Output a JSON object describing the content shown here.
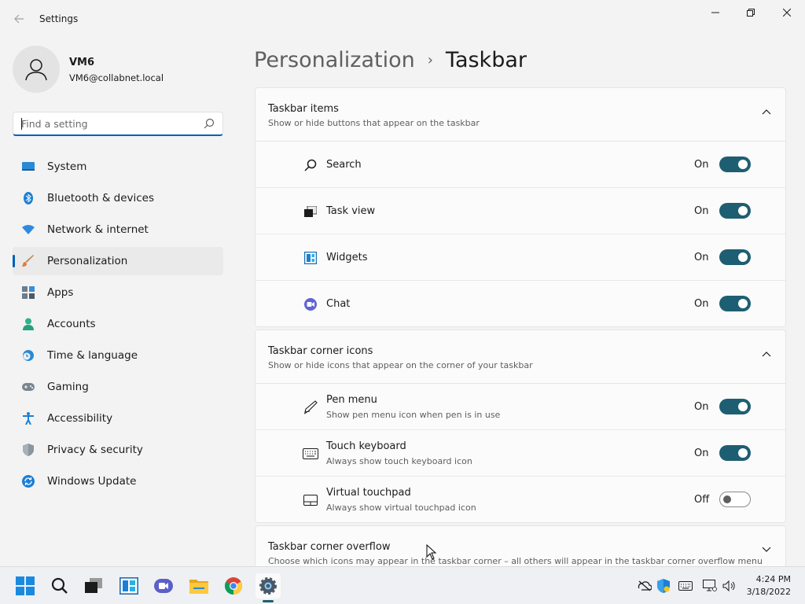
{
  "window": {
    "app_title": "Settings",
    "back_icon": "back-arrow-icon",
    "controls": [
      "minimize-icon",
      "restore-icon",
      "close-icon"
    ]
  },
  "profile": {
    "name": "VM6",
    "email": "VM6@collabnet.local"
  },
  "search": {
    "placeholder": "Find a setting",
    "value": ""
  },
  "sidebar": {
    "items": [
      {
        "label": "System",
        "icon": "system-icon",
        "active": false
      },
      {
        "label": "Bluetooth & devices",
        "icon": "bluetooth-icon",
        "active": false
      },
      {
        "label": "Network & internet",
        "icon": "wifi-icon",
        "active": false
      },
      {
        "label": "Personalization",
        "icon": "brush-icon",
        "active": true
      },
      {
        "label": "Apps",
        "icon": "apps-icon",
        "active": false
      },
      {
        "label": "Accounts",
        "icon": "accounts-icon",
        "active": false
      },
      {
        "label": "Time & language",
        "icon": "clock-globe-icon",
        "active": false
      },
      {
        "label": "Gaming",
        "icon": "gamepad-icon",
        "active": false
      },
      {
        "label": "Accessibility",
        "icon": "accessibility-icon",
        "active": false
      },
      {
        "label": "Privacy & security",
        "icon": "shield-icon",
        "active": false
      },
      {
        "label": "Windows Update",
        "icon": "update-icon",
        "active": false
      }
    ]
  },
  "breadcrumb": {
    "parent": "Personalization",
    "separator": "›",
    "current": "Taskbar"
  },
  "sections": [
    {
      "title": "Taskbar items",
      "subtitle": "Show or hide buttons that appear on the taskbar",
      "expanded": true,
      "rows": [
        {
          "label": "Search",
          "icon": "search-icon",
          "state": "On",
          "on": true
        },
        {
          "label": "Task view",
          "icon": "task-view-icon",
          "state": "On",
          "on": true
        },
        {
          "label": "Widgets",
          "icon": "widgets-icon",
          "state": "On",
          "on": true
        },
        {
          "label": "Chat",
          "icon": "chat-icon",
          "state": "On",
          "on": true
        }
      ]
    },
    {
      "title": "Taskbar corner icons",
      "subtitle": "Show or hide icons that appear on the corner of your taskbar",
      "expanded": true,
      "rows": [
        {
          "label": "Pen menu",
          "sub": "Show pen menu icon when pen is in use",
          "icon": "pen-icon",
          "state": "On",
          "on": true
        },
        {
          "label": "Touch keyboard",
          "sub": "Always show touch keyboard icon",
          "icon": "keyboard-icon",
          "state": "On",
          "on": true
        },
        {
          "label": "Virtual touchpad",
          "sub": "Always show virtual touchpad icon",
          "icon": "touchpad-icon",
          "state": "Off",
          "on": false
        }
      ]
    },
    {
      "title": "Taskbar corner overflow",
      "subtitle": "Choose which icons may appear in the taskbar corner – all others will appear in the taskbar corner overflow menu",
      "expanded": false
    }
  ],
  "taskbar": {
    "apps": [
      "start-icon",
      "search-icon",
      "task-view-icon",
      "widgets-icon",
      "chat-icon",
      "file-explorer-icon",
      "chrome-icon",
      "settings-icon"
    ],
    "active_app": "settings-icon",
    "tray": [
      "network-off-icon",
      "defender-icon",
      "keyboard-icon",
      "display-icon",
      "volume-icon"
    ],
    "time": "4:24 PM",
    "date": "3/18/2022"
  },
  "colors": {
    "accent": "#005fb8",
    "toggle_on": "#1e5e72",
    "background": "#f3f3f3",
    "card": "#fbfbfb"
  }
}
